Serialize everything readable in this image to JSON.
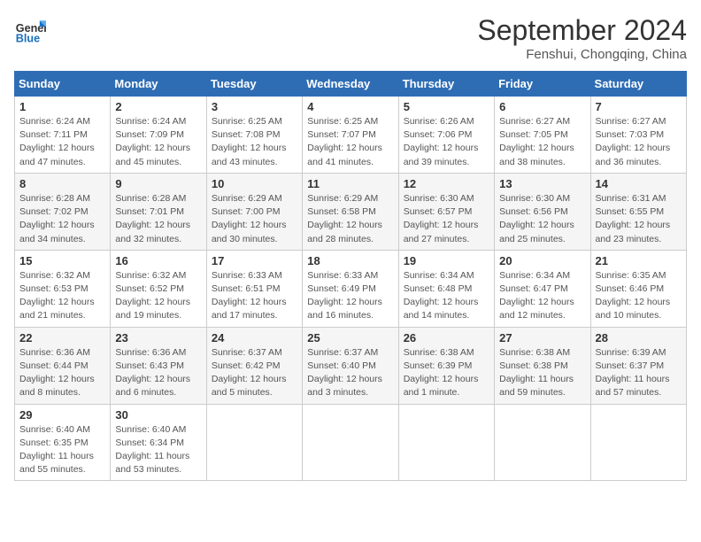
{
  "header": {
    "logo_line1": "General",
    "logo_line2": "Blue",
    "month": "September 2024",
    "location": "Fenshui, Chongqing, China"
  },
  "weekdays": [
    "Sunday",
    "Monday",
    "Tuesday",
    "Wednesday",
    "Thursday",
    "Friday",
    "Saturday"
  ],
  "weeks": [
    [
      {
        "day": "1",
        "sunrise": "6:24 AM",
        "sunset": "7:11 PM",
        "daylight": "12 hours and 47 minutes."
      },
      {
        "day": "2",
        "sunrise": "6:24 AM",
        "sunset": "7:09 PM",
        "daylight": "12 hours and 45 minutes."
      },
      {
        "day": "3",
        "sunrise": "6:25 AM",
        "sunset": "7:08 PM",
        "daylight": "12 hours and 43 minutes."
      },
      {
        "day": "4",
        "sunrise": "6:25 AM",
        "sunset": "7:07 PM",
        "daylight": "12 hours and 41 minutes."
      },
      {
        "day": "5",
        "sunrise": "6:26 AM",
        "sunset": "7:06 PM",
        "daylight": "12 hours and 39 minutes."
      },
      {
        "day": "6",
        "sunrise": "6:27 AM",
        "sunset": "7:05 PM",
        "daylight": "12 hours and 38 minutes."
      },
      {
        "day": "7",
        "sunrise": "6:27 AM",
        "sunset": "7:03 PM",
        "daylight": "12 hours and 36 minutes."
      }
    ],
    [
      {
        "day": "8",
        "sunrise": "6:28 AM",
        "sunset": "7:02 PM",
        "daylight": "12 hours and 34 minutes."
      },
      {
        "day": "9",
        "sunrise": "6:28 AM",
        "sunset": "7:01 PM",
        "daylight": "12 hours and 32 minutes."
      },
      {
        "day": "10",
        "sunrise": "6:29 AM",
        "sunset": "7:00 PM",
        "daylight": "12 hours and 30 minutes."
      },
      {
        "day": "11",
        "sunrise": "6:29 AM",
        "sunset": "6:58 PM",
        "daylight": "12 hours and 28 minutes."
      },
      {
        "day": "12",
        "sunrise": "6:30 AM",
        "sunset": "6:57 PM",
        "daylight": "12 hours and 27 minutes."
      },
      {
        "day": "13",
        "sunrise": "6:30 AM",
        "sunset": "6:56 PM",
        "daylight": "12 hours and 25 minutes."
      },
      {
        "day": "14",
        "sunrise": "6:31 AM",
        "sunset": "6:55 PM",
        "daylight": "12 hours and 23 minutes."
      }
    ],
    [
      {
        "day": "15",
        "sunrise": "6:32 AM",
        "sunset": "6:53 PM",
        "daylight": "12 hours and 21 minutes."
      },
      {
        "day": "16",
        "sunrise": "6:32 AM",
        "sunset": "6:52 PM",
        "daylight": "12 hours and 19 minutes."
      },
      {
        "day": "17",
        "sunrise": "6:33 AM",
        "sunset": "6:51 PM",
        "daylight": "12 hours and 17 minutes."
      },
      {
        "day": "18",
        "sunrise": "6:33 AM",
        "sunset": "6:49 PM",
        "daylight": "12 hours and 16 minutes."
      },
      {
        "day": "19",
        "sunrise": "6:34 AM",
        "sunset": "6:48 PM",
        "daylight": "12 hours and 14 minutes."
      },
      {
        "day": "20",
        "sunrise": "6:34 AM",
        "sunset": "6:47 PM",
        "daylight": "12 hours and 12 minutes."
      },
      {
        "day": "21",
        "sunrise": "6:35 AM",
        "sunset": "6:46 PM",
        "daylight": "12 hours and 10 minutes."
      }
    ],
    [
      {
        "day": "22",
        "sunrise": "6:36 AM",
        "sunset": "6:44 PM",
        "daylight": "12 hours and 8 minutes."
      },
      {
        "day": "23",
        "sunrise": "6:36 AM",
        "sunset": "6:43 PM",
        "daylight": "12 hours and 6 minutes."
      },
      {
        "day": "24",
        "sunrise": "6:37 AM",
        "sunset": "6:42 PM",
        "daylight": "12 hours and 5 minutes."
      },
      {
        "day": "25",
        "sunrise": "6:37 AM",
        "sunset": "6:40 PM",
        "daylight": "12 hours and 3 minutes."
      },
      {
        "day": "26",
        "sunrise": "6:38 AM",
        "sunset": "6:39 PM",
        "daylight": "12 hours and 1 minute."
      },
      {
        "day": "27",
        "sunrise": "6:38 AM",
        "sunset": "6:38 PM",
        "daylight": "11 hours and 59 minutes."
      },
      {
        "day": "28",
        "sunrise": "6:39 AM",
        "sunset": "6:37 PM",
        "daylight": "11 hours and 57 minutes."
      }
    ],
    [
      {
        "day": "29",
        "sunrise": "6:40 AM",
        "sunset": "6:35 PM",
        "daylight": "11 hours and 55 minutes."
      },
      {
        "day": "30",
        "sunrise": "6:40 AM",
        "sunset": "6:34 PM",
        "daylight": "11 hours and 53 minutes."
      },
      null,
      null,
      null,
      null,
      null
    ]
  ]
}
